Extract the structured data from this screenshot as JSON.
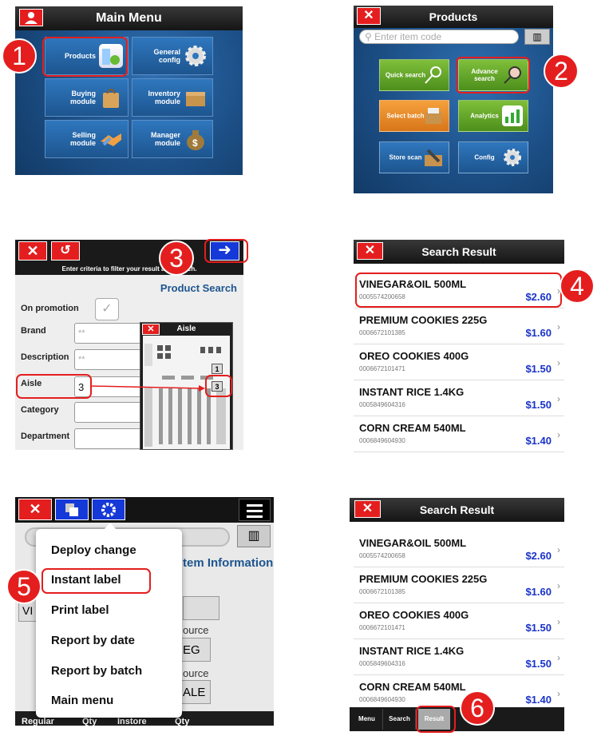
{
  "panel1": {
    "title": "Main Menu",
    "tiles": [
      {
        "label": "Products",
        "icon": "products-icon"
      },
      {
        "label": "General config",
        "icon": "gear-icon"
      },
      {
        "label": "Buying module",
        "icon": "shopping-bag-icon"
      },
      {
        "label": "Inventory module",
        "icon": "box-icon"
      },
      {
        "label": "Selling module",
        "icon": "handshake-icon"
      },
      {
        "label": "Manager module",
        "icon": "money-bag-icon"
      }
    ]
  },
  "panel2": {
    "title": "Products",
    "search_placeholder": "Enter item code",
    "tiles": [
      {
        "label": "Quick search",
        "icon": "magnifier-icon"
      },
      {
        "label": "Advance search",
        "icon": "advanced-search-icon"
      },
      {
        "label": "Select batch",
        "icon": "batch-icon"
      },
      {
        "label": "Analytics",
        "icon": "chart-icon"
      },
      {
        "label": "Store scan",
        "icon": "scanner-icon"
      },
      {
        "label": "Config",
        "icon": "gear-icon"
      }
    ]
  },
  "panel3": {
    "hint": "Enter criteria to filter your result and search.",
    "title": "Product Search",
    "fields": [
      {
        "label": "On promotion",
        "value": ""
      },
      {
        "label": "Brand",
        "value": "**"
      },
      {
        "label": "Description",
        "value": "**"
      },
      {
        "label": "Aisle",
        "value": "3"
      },
      {
        "label": "Category",
        "value": ""
      },
      {
        "label": "Department",
        "value": ""
      }
    ],
    "aisle_popup": {
      "title": "Aisle",
      "markers": [
        "1",
        "3"
      ]
    }
  },
  "panel4": {
    "title": "Search Result",
    "results": [
      {
        "name": "VINEGAR&OIL 500ML",
        "code": "0005574200658",
        "price": "$2.60"
      },
      {
        "name": "PREMIUM COOKIES 225G",
        "code": "0006672101385",
        "price": "$1.60"
      },
      {
        "name": "OREO COOKIES 400G",
        "code": "0006672101471",
        "price": "$1.50"
      },
      {
        "name": "INSTANT RICE 1.4KG",
        "code": "0005849604316",
        "price": "$1.50"
      },
      {
        "name": "CORN CREAM 540ML",
        "code": "0006849604930",
        "price": "$1.40"
      }
    ]
  },
  "panel5": {
    "menu": [
      "Deploy change",
      "Instant label",
      "Print label",
      "Report by date",
      "Report by batch",
      "Main menu"
    ],
    "bg": {
      "code_fragment": "00",
      "value_fragment": "VI",
      "heading": "tem Information",
      "source1": "ource",
      "source1_value": "EG",
      "source2": "ource",
      "source2_value": "ALE",
      "bottom_labels": [
        "Regular",
        "Qty",
        "Instore",
        "Qty"
      ]
    }
  },
  "panel6": {
    "title": "Search Result",
    "results": [
      {
        "name": "VINEGAR&OIL 500ML",
        "code": "0005574200658",
        "price": "$2.60"
      },
      {
        "name": "PREMIUM COOKIES 225G",
        "code": "0006672101385",
        "price": "$1.60"
      },
      {
        "name": "OREO COOKIES 400G",
        "code": "0006672101471",
        "price": "$1.50"
      },
      {
        "name": "INSTANT RICE 1.4KG",
        "code": "0005849604316",
        "price": "$1.50"
      },
      {
        "name": "CORN CREAM 540ML",
        "code": "0006849604930",
        "price": "$1.40"
      }
    ],
    "tabs": [
      "Menu",
      "Search",
      "Result"
    ]
  },
  "steps": [
    "1",
    "2",
    "3",
    "4",
    "5",
    "6"
  ],
  "colors": {
    "accent_red": "#e41e1e",
    "price_blue": "#1a33c8",
    "tile_blue": "#1d558f",
    "tile_green": "#4d8f1c",
    "tile_orange": "#d8761a"
  }
}
